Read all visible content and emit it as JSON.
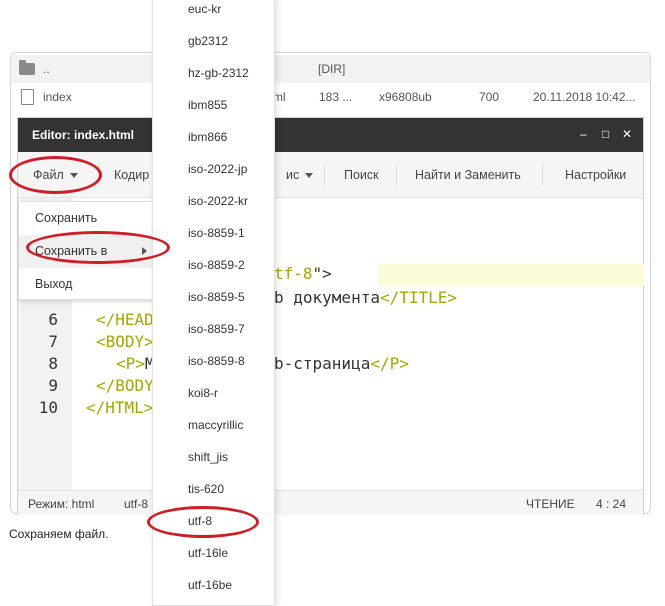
{
  "file_manager": {
    "rows": [
      {
        "name": "..",
        "type": "[DIR]"
      },
      {
        "name": "index",
        "ext": "ml",
        "size": "183 ...",
        "owner": "x96808ub",
        "perms": "700",
        "date": "20.11.2018 10:42..."
      }
    ]
  },
  "editor": {
    "title": "Editor: index.html",
    "controls": {
      "minimize": "–",
      "maximize": "□",
      "close": "✕"
    },
    "menu": {
      "file": "Файл",
      "encoding": "Кодир",
      "syntax_fragment": "ис",
      "search": "Поиск",
      "find_replace": "Найти и Заменить",
      "settings": "Настройки"
    },
    "code": {
      "line_numbers": [
        "6",
        "7",
        "8",
        "9",
        "10"
      ],
      "frag_meta_value": "tf-8",
      "frag_meta_end": "\">",
      "frag_title_text": "b документа",
      "frag_title_close": "</TITLE>",
      "line6": "</HEAD",
      "line7": "<BODY>",
      "line8_open": "<P>",
      "line8_text": "M",
      "line8_frag": "b-страница",
      "line8_close": "</P>",
      "line9": "</BODY",
      "line10": "</HTML>"
    },
    "status": {
      "mode": "Режим: html",
      "encoding": "utf-8",
      "state": "ЧТЕНИЕ",
      "position": "4 : 24"
    }
  },
  "file_menu": {
    "items": [
      "Сохранить",
      "Сохранить в",
      "Выход"
    ]
  },
  "encodings": [
    "euc-kr",
    "gb2312",
    "hz-gb-2312",
    "ibm855",
    "ibm866",
    "iso-2022-jp",
    "iso-2022-kr",
    "iso-8859-1",
    "iso-8859-2",
    "iso-8859-5",
    "iso-8859-7",
    "iso-8859-8",
    "koi8-r",
    "maccyrillic",
    "shift_jis",
    "tis-620",
    "utf-8",
    "utf-16le",
    "utf-16be"
  ],
  "caption": "Сохраняем файл.",
  "colors": {
    "highlight_ring": "#cc1f28",
    "titlebar": "#333333",
    "tag": "#a6a600"
  }
}
